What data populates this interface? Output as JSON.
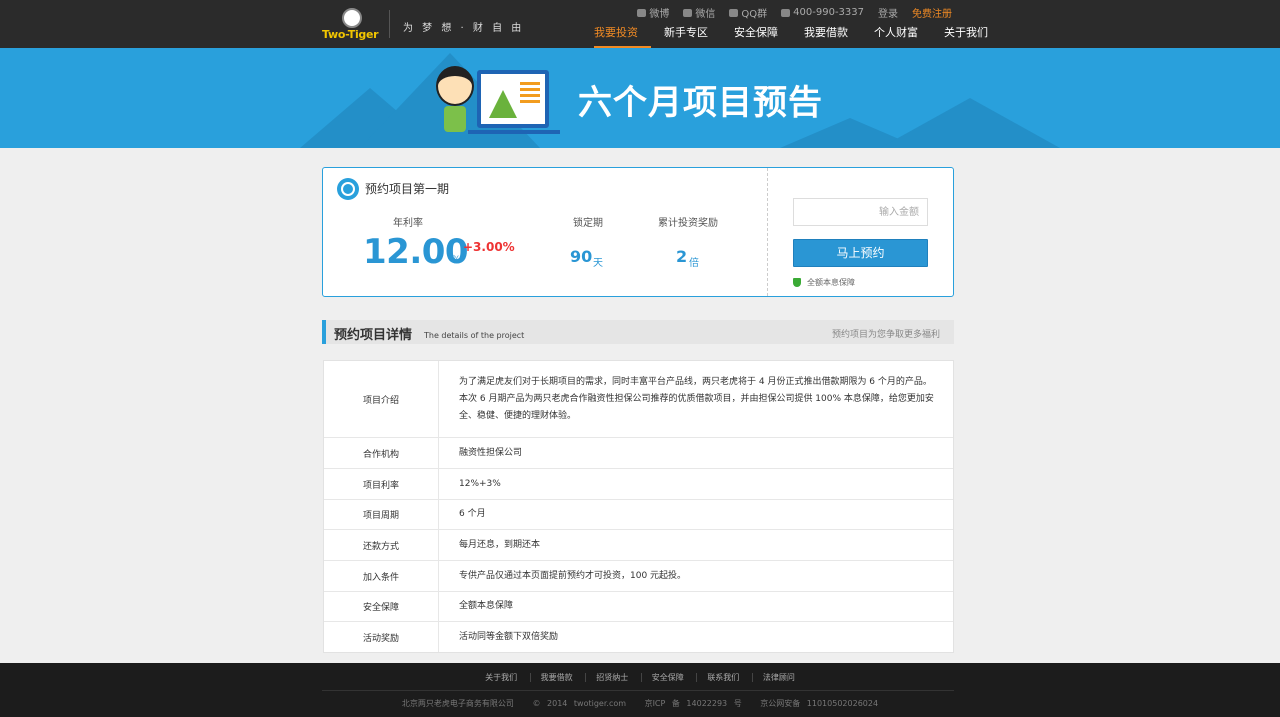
{
  "header": {
    "logo_text": "Two-Tiger",
    "slogan": "为 梦 想 · 财 自 由",
    "top_links": {
      "weibo": "微博",
      "wechat": "微信",
      "qq": "QQ群",
      "phone": "400-990-3337",
      "login": "登录",
      "register": "免费注册"
    },
    "nav": [
      "我要投资",
      "新手专区",
      "安全保障",
      "我要借款",
      "个人财富",
      "关于我们"
    ]
  },
  "banner": {
    "title": "六个月项目预告"
  },
  "project": {
    "title": "预约项目第一期",
    "rate_label": "年利率",
    "rate": "12.00",
    "rate_unit": "%",
    "bonus": "+3.00%",
    "lock_label": "锁定期",
    "lock_value": "90",
    "lock_unit": "天",
    "reward_label": "累计投资奖励",
    "reward_value": "2",
    "reward_unit": "倍",
    "amount_placeholder": "输入金额",
    "reserve_button": "马上预约",
    "guarantee": "全额本息保障"
  },
  "details": {
    "title": "预约项目详情",
    "subtitle": "The details of the project",
    "right_note": "预约项目为您争取更多福利",
    "rows": [
      {
        "key": "项目介绍",
        "value": "为了满足虎友们对于长期项目的需求，同时丰富平台产品线，两只老虎将于 4 月份正式推出借款期限为 6 个月的产品。本次 6 月期产品为两只老虎合作融资性担保公司推荐的优质借款项目，并由担保公司提供 100% 本息保障，给您更加安全、稳健、便捷的理财体验。"
      },
      {
        "key": "合作机构",
        "value": "融资性担保公司"
      },
      {
        "key": "项目利率",
        "value": "12%+3%"
      },
      {
        "key": "项目周期",
        "value": "6 个月"
      },
      {
        "key": "还款方式",
        "value": "每月还息，到期还本"
      },
      {
        "key": "加入条件",
        "value": "专供产品仅通过本页面提前预约才可投资，100 元起投。"
      },
      {
        "key": "安全保障",
        "value": "全额本息保障"
      },
      {
        "key": "活动奖励",
        "value": "活动同等金额下双倍奖励"
      }
    ]
  },
  "footer": {
    "links": [
      "关于我们",
      "我要借款",
      "招贤纳士",
      "安全保障",
      "联系我们",
      "法律顾问"
    ],
    "company": "北京两只老虎电子商务有限公司",
    "copyright": "© 2014 twotiger.com",
    "icp": "京ICP 备 14022293 号",
    "police": "京公网安备 11010502026024"
  },
  "colors": {
    "accent_blue": "#29a0dc",
    "nav_active": "#f08a24",
    "bonus_red": "#ee3333",
    "header_bg": "#2b2b2b"
  }
}
